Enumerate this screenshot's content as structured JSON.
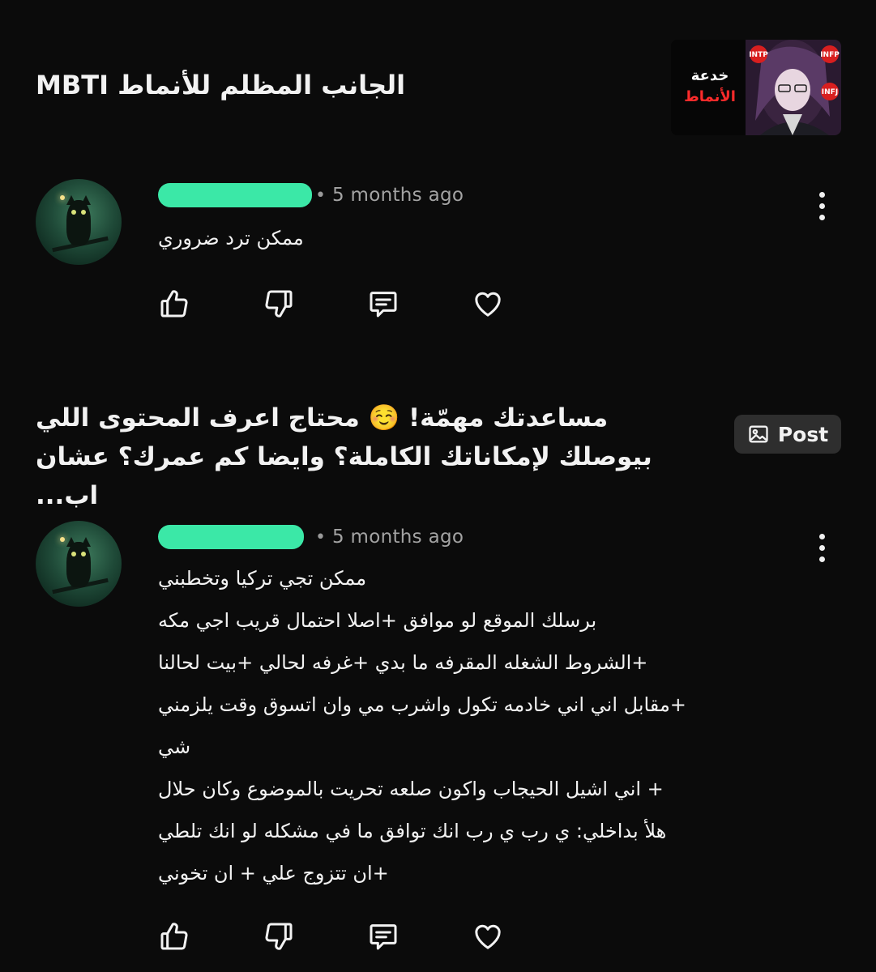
{
  "post": {
    "title": "الجانب المظلم للأنماط MBTI",
    "thumbnail": {
      "text_line1": "خدعة",
      "text_line2": "الأنماط",
      "tags": [
        "INTP",
        "INFP",
        "INFJ"
      ]
    }
  },
  "comments": [
    {
      "time": "5 months ago",
      "lines": [
        "ممكن ترد ضروري"
      ]
    },
    {
      "time": "5 months ago",
      "lines": [
        "ممكن تجي تركيا وتخطبني",
        "برسلك الموقع لو موافق +اصلا احتمال قريب اجي مكه",
        "+الشروط الشغله المقرفه ما بدي +غرفه لحالي +بيت لحالنا",
        "+مقابل اني اني خادمه تكول واشرب مي وان  اتسوق  وقت يلزمني",
        "شي",
        "+ اني اشيل الحيجاب واكون صلعه تحريت بالموضوع وكان حلال",
        "هلأ بداخلي: ي رب ي رب انك توافق ما في مشكله لو انك  تلطي",
        "+ان تتزوج علي + ان تخوني"
      ]
    }
  ],
  "suggestion": {
    "line1": "مساعدتك مهمّة! ☺️ محتاج اعرف المحتوى اللي",
    "line2": "بيوصلك لإمكاناتك الكاملة؟ وايضا كم عمرك؟ عشان اب...",
    "button_label": "Post"
  },
  "icons": {
    "like": "thumbs-up-icon",
    "dislike": "thumbs-down-icon",
    "reply": "comment-icon",
    "heart": "heart-icon",
    "more": "more-vertical-icon"
  },
  "colors": {
    "background": "#0b0b0b",
    "redaction": "#3be8a7",
    "button_bg": "#2e2e2e"
  }
}
